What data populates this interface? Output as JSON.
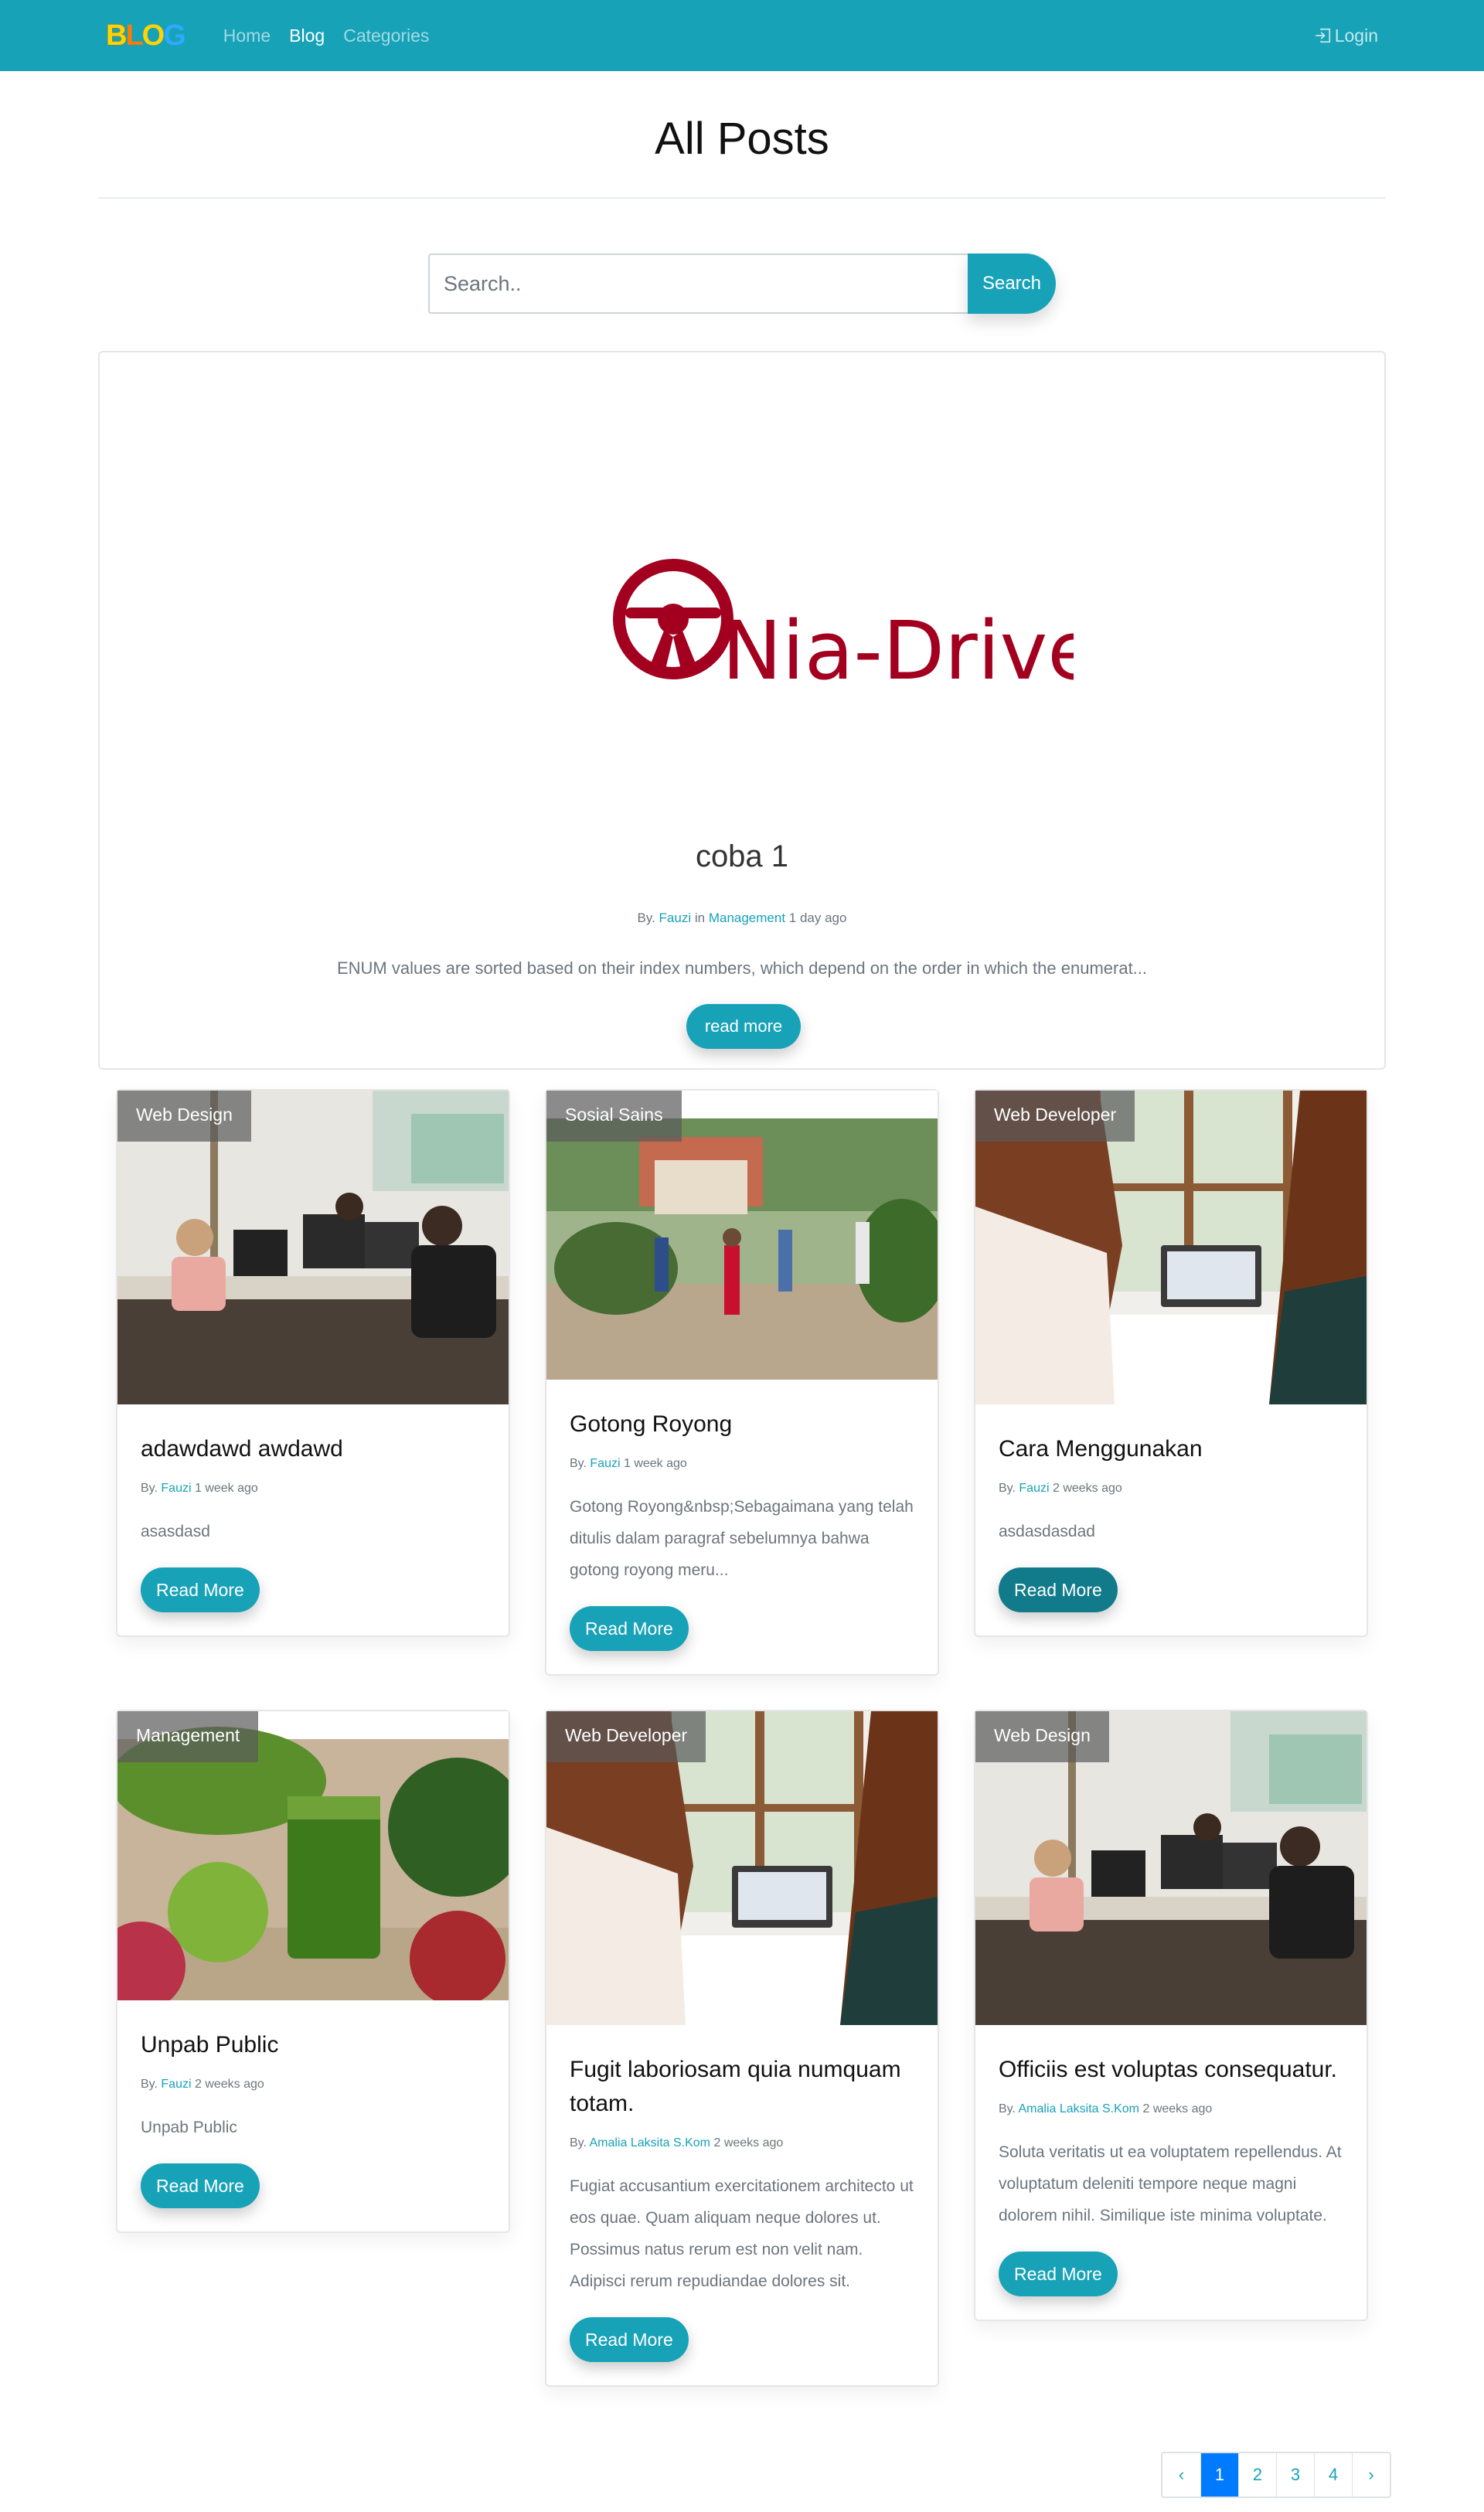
{
  "navbar": {
    "brand": [
      "B",
      "L",
      "O",
      "G"
    ],
    "links": [
      "Home",
      "Blog",
      "Categories"
    ],
    "active_index": 1,
    "login": "Login"
  },
  "page": {
    "title": "All Posts"
  },
  "search": {
    "placeholder": "Search..",
    "button": "Search"
  },
  "featured": {
    "logo_text": "Nia-Drive",
    "title": "coba 1",
    "meta": {
      "by": "By.",
      "author": "Fauzi",
      "in": "in",
      "category": "Management",
      "time": "1 day ago"
    },
    "excerpt": "ENUM values are sorted based on their index numbers, which depend on the order in which the enumerat...",
    "button": "read more"
  },
  "posts": [
    {
      "category": "Web Design",
      "title": "adawdawd awdawd",
      "by": "By.",
      "author": "Fauzi",
      "time": "1 week ago",
      "excerpt": "asasdasd",
      "button": "Read More"
    },
    {
      "category": "Sosial Sains",
      "title": "Gotong Royong",
      "by": "By.",
      "author": "Fauzi",
      "time": "1 week ago",
      "excerpt": "Gotong Royong&nbsp;Sebagaimana yang telah ditulis dalam paragraf sebelumnya bahwa gotong royong meru...",
      "button": "Read More"
    },
    {
      "category": "Web Developer",
      "title": "Cara Menggunakan",
      "by": "By.",
      "author": "Fauzi",
      "time": "2 weeks ago",
      "excerpt": "asdasdasdad",
      "button": "Read More"
    },
    {
      "category": "Management",
      "title": "Unpab Public",
      "by": "By.",
      "author": "Fauzi",
      "time": "2 weeks ago",
      "excerpt": "Unpab Public",
      "button": "Read More"
    },
    {
      "category": "Web Developer",
      "title": "Fugit laboriosam quia numquam totam.",
      "by": "By.",
      "author": "Amalia Laksita S.Kom",
      "time": "2 weeks ago",
      "excerpt": "Fugiat accusantium exercitationem architecto ut eos quae. Quam aliquam neque dolores ut. Possimus natus rerum est non velit nam. Adipisci rerum repudiandae dolores sit.",
      "button": "Read More"
    },
    {
      "category": "Web Design",
      "title": "Officiis est voluptas consequatur.",
      "by": "By.",
      "author": "Amalia Laksita S.Kom",
      "time": "2 weeks ago",
      "excerpt": "Soluta veritatis ut ea voluptatem repellendus. At voluptatum deleniti tempore neque magni dolorem nihil. Similique iste minima voluptate.",
      "button": "Read More"
    }
  ],
  "pagination": {
    "prev": "‹",
    "pages": [
      "1",
      "2",
      "3",
      "4"
    ],
    "next": "›",
    "active_page": "1"
  },
  "colors": {
    "primary": "#17a2b8",
    "primary_dark": "#117a8b",
    "page_active": "#007bff",
    "logo_red": "#a3001f"
  },
  "icons": {
    "login": "sign-in-icon"
  }
}
